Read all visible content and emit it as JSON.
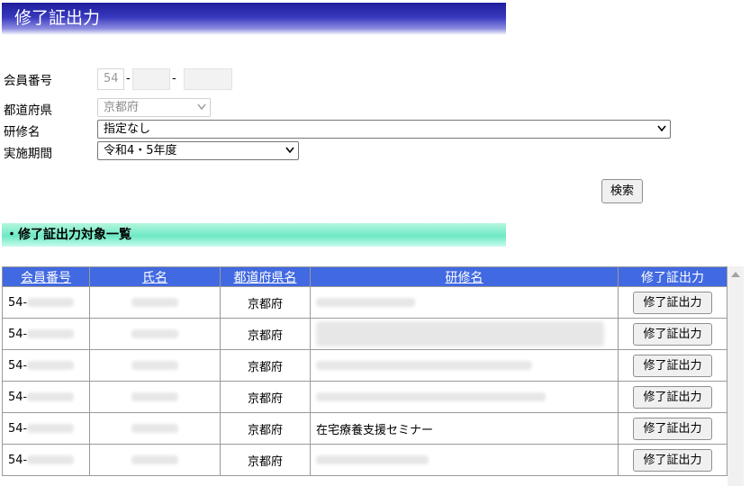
{
  "header": {
    "title": "修了証出力"
  },
  "form": {
    "member_no_label": "会員番号",
    "member_no_prefix": "54",
    "dash": "-",
    "prefecture_label": "都道府県",
    "prefecture_value": "京都府",
    "course_label": "研修名",
    "course_value": "指定なし",
    "period_label": "実施期間",
    "period_value": "令和4・5年度",
    "search_label": "検索"
  },
  "section": {
    "title": "・修了証出力対象一覧"
  },
  "table": {
    "headers": [
      "会員番号",
      "氏名",
      "都道府県名",
      "研修名",
      "修了証出力"
    ],
    "rows": [
      {
        "member_prefix": "54-",
        "prefecture": "京都府",
        "course": "",
        "button": "修了証出力"
      },
      {
        "member_prefix": "54-",
        "prefecture": "京都府",
        "course": "",
        "button": "修了証出力"
      },
      {
        "member_prefix": "54-",
        "prefecture": "京都府",
        "course": "",
        "button": "修了証出力"
      },
      {
        "member_prefix": "54-",
        "prefecture": "京都府",
        "course": "",
        "button": "修了証出力"
      },
      {
        "member_prefix": "54-",
        "prefecture": "京都府",
        "course": "在宅療養支援セミナー",
        "button": "修了証出力"
      },
      {
        "member_prefix": "54-",
        "prefecture": "京都府",
        "course": "",
        "button": "修了証出力"
      }
    ]
  },
  "icons": {
    "dropdown": "chevron-down-icon",
    "scroll_up": "scroll-up-arrow-icon"
  }
}
